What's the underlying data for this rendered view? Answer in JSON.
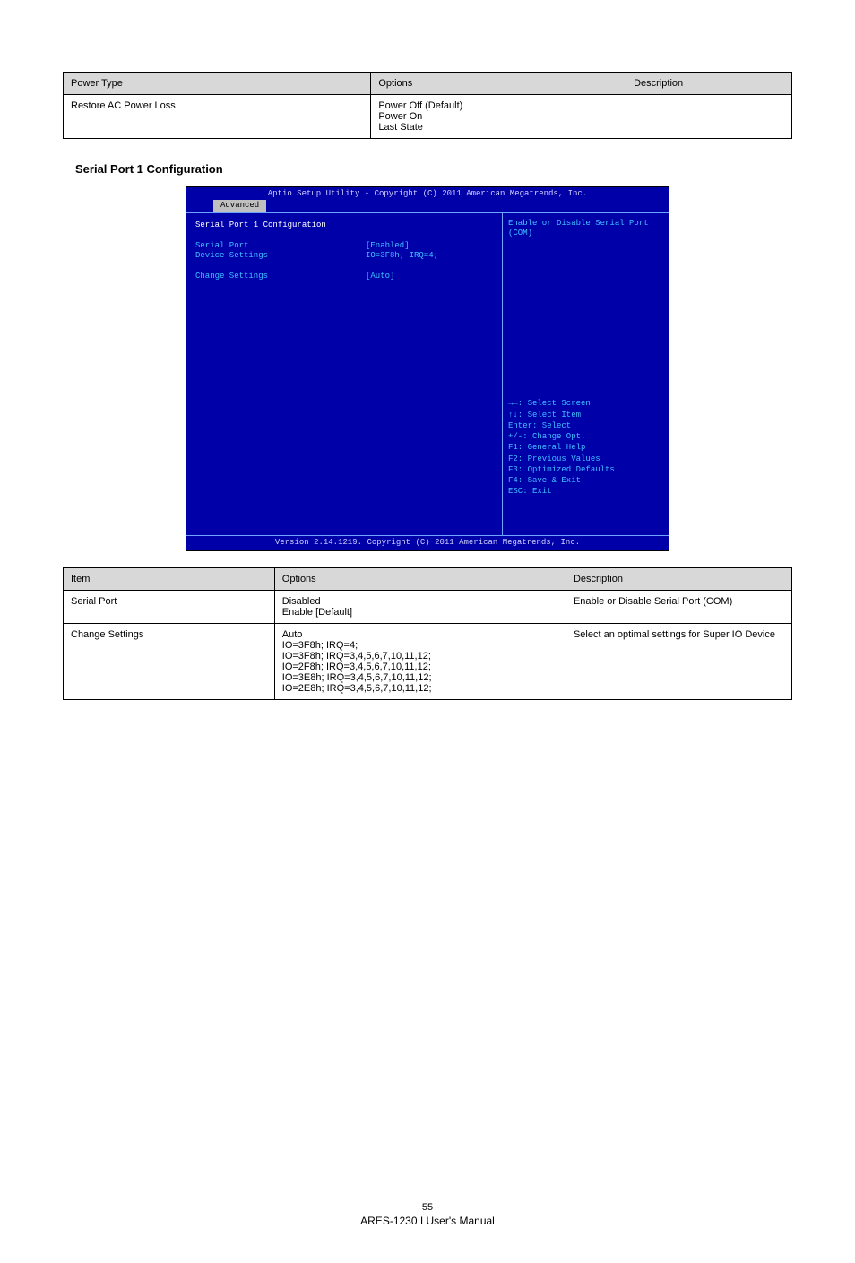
{
  "topTable": {
    "headers": [
      "Power Type",
      "Options",
      "Description"
    ],
    "row": [
      "Restore AC Power Loss",
      "Power Off (Default)\nPower On\nLast State",
      ""
    ]
  },
  "sectionTitle": "Serial Port 1 Configuration",
  "bios": {
    "title": "Aptio Setup Utility - Copyright (C) 2011 American Megatrends, Inc.",
    "tab": "Advanced",
    "heading": "Serial Port 1 Configuration",
    "rows": [
      {
        "label": "Serial Port",
        "value": "[Enabled]",
        "style": "cyan"
      },
      {
        "label": "Device Settings",
        "value": "IO=3F8h; IRQ=4;",
        "style": "cyan"
      },
      {
        "label": "",
        "value": "",
        "style": "space"
      },
      {
        "label": "Change Settings",
        "value": "[Auto]",
        "style": "cyan"
      }
    ],
    "helpTop": "Enable or Disable Serial Port (COM)",
    "keys": [
      "→←: Select Screen",
      "↑↓: Select Item",
      "Enter: Select",
      "+/-: Change Opt.",
      "F1: General Help",
      "F2: Previous Values",
      "F3: Optimized Defaults",
      "F4: Save & Exit",
      "ESC: Exit"
    ],
    "footer": "Version 2.14.1219. Copyright (C) 2011 American Megatrends, Inc."
  },
  "bottomTable": {
    "headers": [
      "Item",
      "Options",
      "Description"
    ],
    "rows": [
      [
        "Serial Port",
        "Disabled\nEnable [Default]",
        "Enable or Disable Serial Port (COM)"
      ],
      [
        "Change Settings",
        "Auto\nIO=3F8h; IRQ=4;\nIO=3F8h; IRQ=3,4,5,6,7,10,11,12;\nIO=2F8h; IRQ=3,4,5,6,7,10,11,12;\nIO=3E8h; IRQ=3,4,5,6,7,10,11,12;\nIO=2E8h; IRQ=3,4,5,6,7,10,11,12;",
        "Select an optimal settings for Super IO Device"
      ]
    ]
  },
  "pageNumber": "55",
  "footerModel": "ARES-1230 I User's Manual"
}
